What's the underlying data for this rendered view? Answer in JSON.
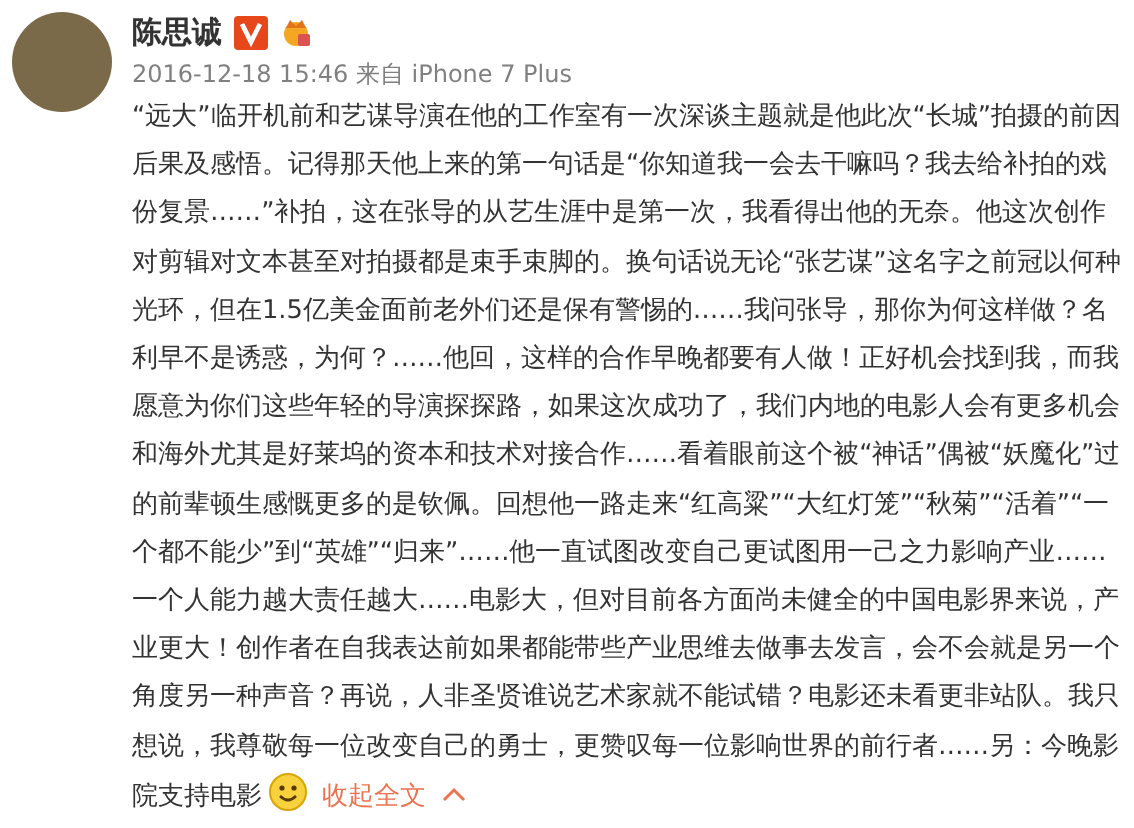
{
  "post": {
    "author": "陈思诚",
    "meta": "2016-12-18 15:46 来自 iPhone 7 Plus",
    "text": "“远大”临开机前和艺谋导演在他的工作室有一次深谈主题就是他此次“长城”拍摄的前因后果及感悟。记得那天他上来的第一句话是“你知道我一会去干嘛吗？我去给补拍的戏份复景……”补拍，这在张导的从艺生涯中是第一次，我看得出他的无奈。他这次创作对剪辑对文本甚至对拍摄都是束手束脚的。换句话说无论“张艺谋”这名字之前冠以何种光环，但在1.5亿美金面前老外们还是保有警惕的……我问张导，那你为何这样做？名利早不是诱惑，为何？……他回，这样的合作早晚都要有人做！正好机会找到我，而我愿意为你们这些年轻的导演探探路，如果这次成功了，我们内地的电影人会有更多机会和海外尤其是好莱坞的资本和技术对接合作……看着眼前这个被“神话”偶被“妖魔化”过的前辈顿生感慨更多的是钦佩。回想他一路走来“红高粱”“大红灯笼”“秋菊”“活着”“一个都不能少”到“英雄”“归来”……他一直试图改变自己更试图用一己之力影响产业……一个人能力越大责任越大……电影大，但对目前各方面尚未健全的中国电影界来说，产业更大！创作者在自我表达前如果都能带些产业思维去做事去发言，会不会就是另一个角度另一种声音？再说，人非圣贤谁说艺术家就不能试错？电影还未看更非站队。我只想说，我尊敬每一位改变自己的勇士，更赞叹每一位影响世界的前行者……另：今晚影院支持电影",
    "collapse_link": "收起全文"
  }
}
